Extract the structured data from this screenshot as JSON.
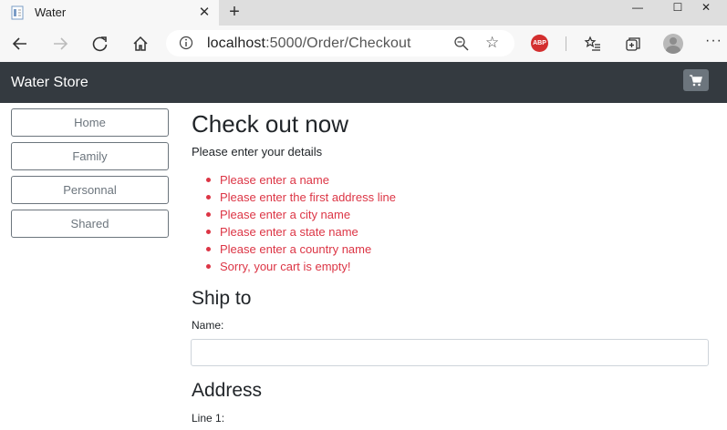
{
  "browser": {
    "tab_title": "Water",
    "url_host": "localhost",
    "url_path": ":5000/Order/Checkout",
    "new_tab_symbol": "+",
    "close_symbol": "✕",
    "abp_label": "ABP",
    "window_controls": [
      "—",
      "☐",
      "✕"
    ],
    "more_symbol": "···"
  },
  "navbar": {
    "brand": "Water Store",
    "cart_icon": "cart-icon"
  },
  "sidebar": {
    "items": [
      {
        "label": "Home"
      },
      {
        "label": "Family"
      },
      {
        "label": "Personnal"
      },
      {
        "label": "Shared"
      }
    ]
  },
  "main": {
    "title": "Check out now",
    "subtitle": "Please enter your details",
    "errors": [
      "Please enter a name",
      "Please enter the first address line",
      "Please enter a city name",
      "Please enter a state name",
      "Please enter a country name",
      "Sorry, your cart is empty!"
    ],
    "ship_heading": "Ship to",
    "name_label": "Name:",
    "name_value": "",
    "address_heading": "Address",
    "line1_label": "Line 1:"
  },
  "colors": {
    "navbar": "#343a40",
    "error": "#dc3545",
    "sidebar_border": "#6c757d"
  }
}
